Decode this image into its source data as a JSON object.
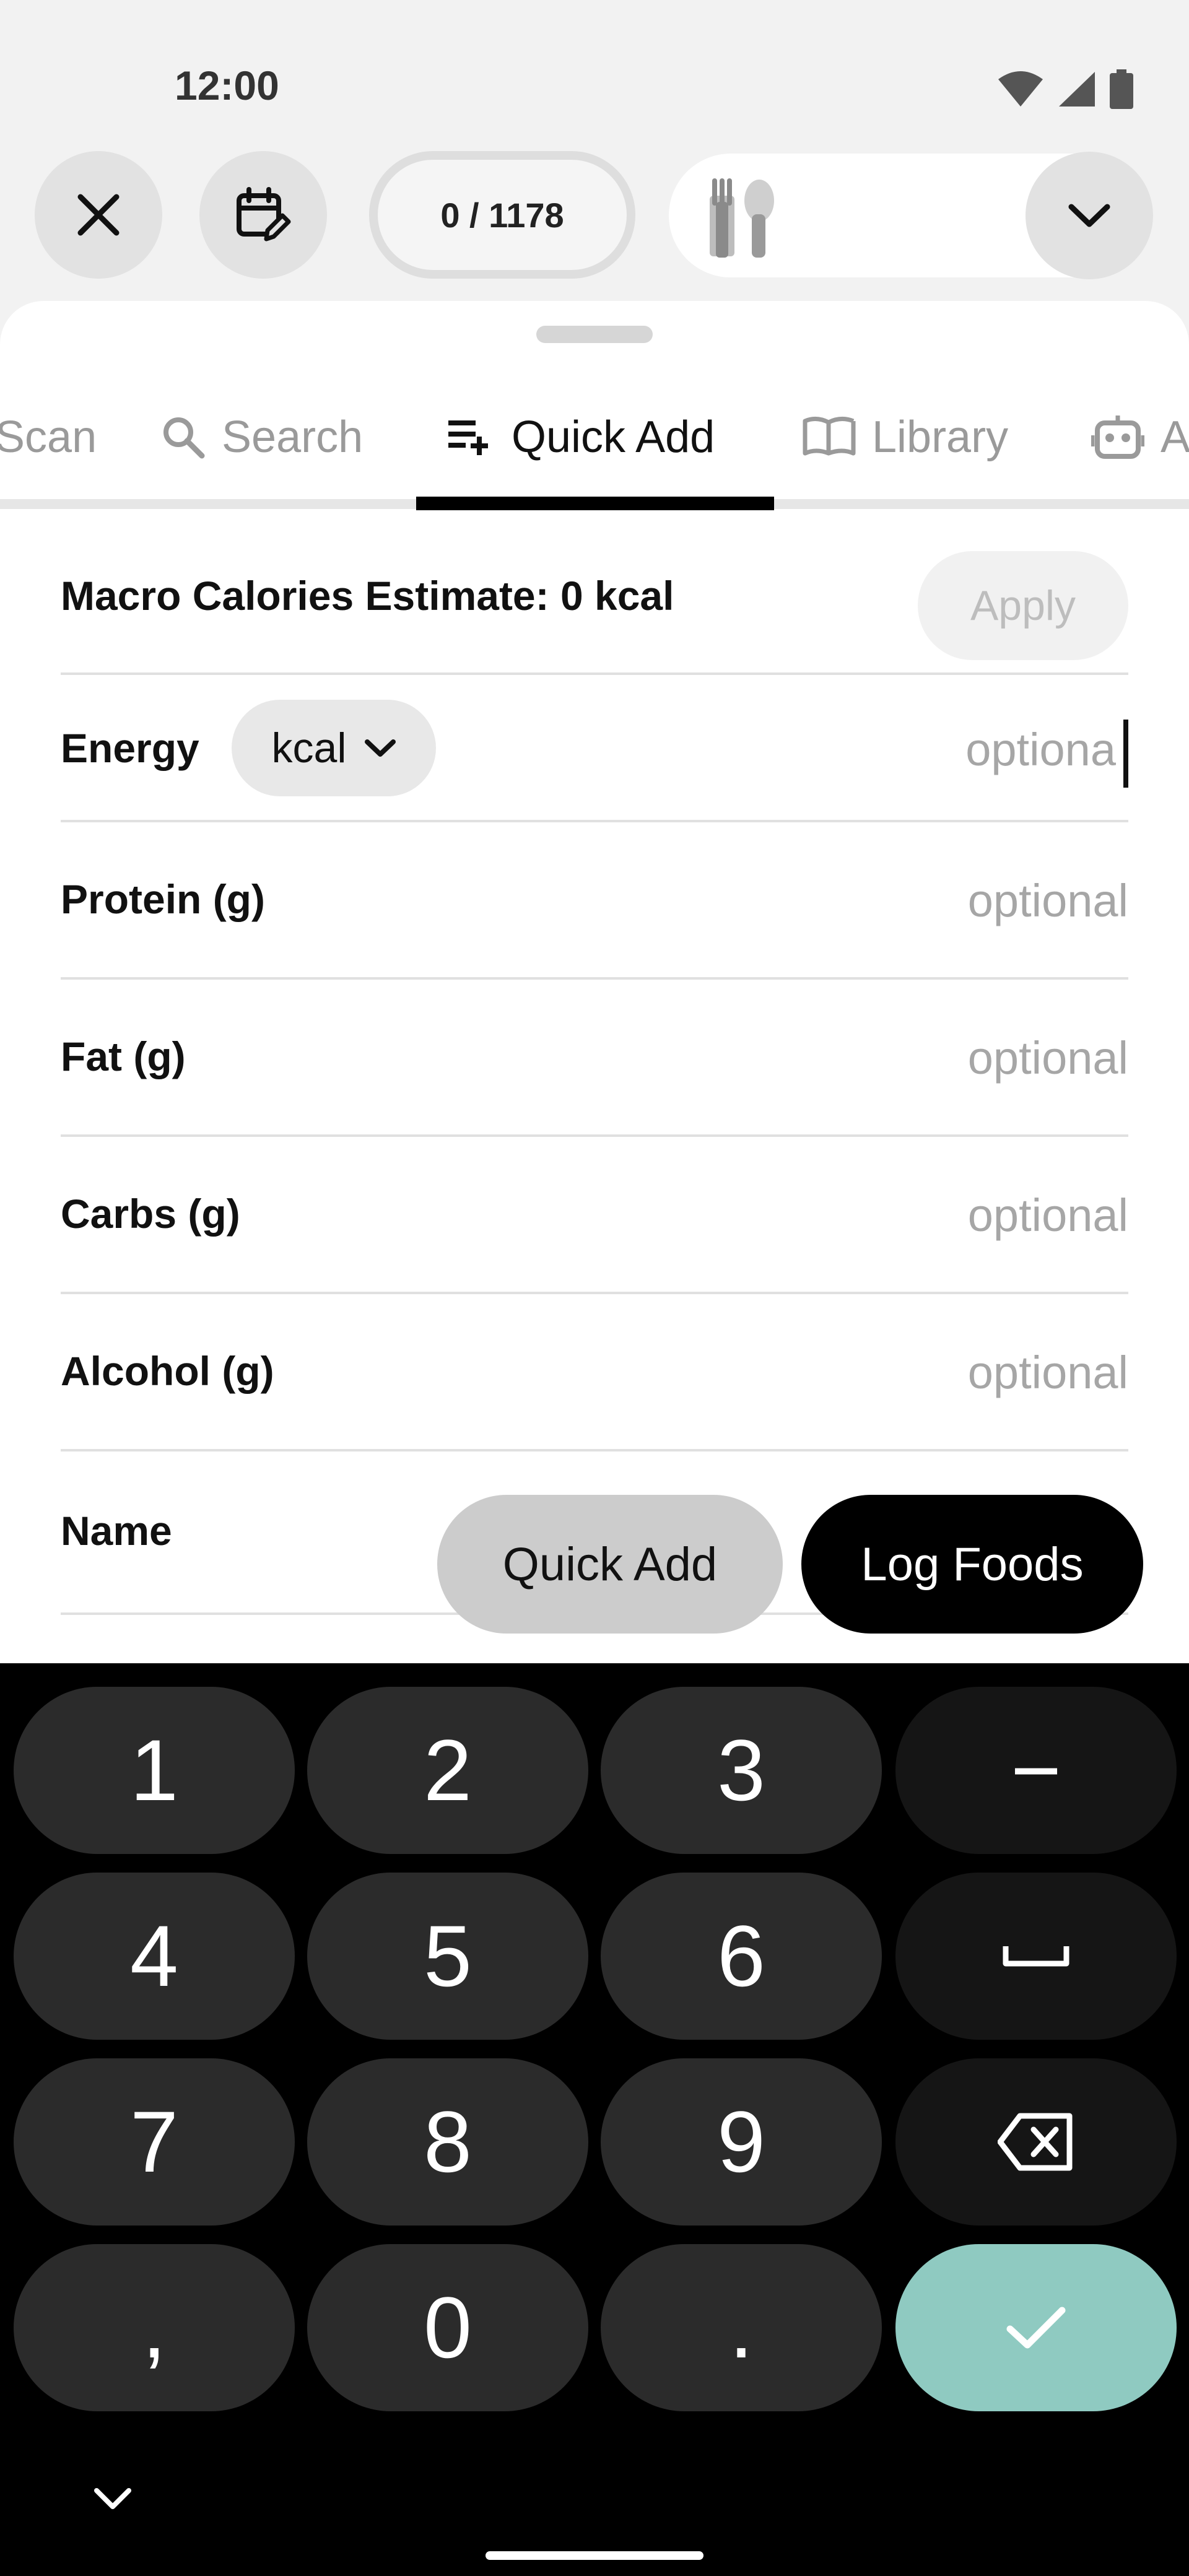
{
  "status_bar": {
    "time": "12:00"
  },
  "top_bar": {
    "counter": "0 / 1178"
  },
  "tabs": [
    {
      "label": "Scan"
    },
    {
      "label": "Search"
    },
    {
      "label": "Quick Add"
    },
    {
      "label": "Library"
    },
    {
      "label": "A"
    }
  ],
  "form": {
    "macro_estimate": "Macro Calories Estimate: 0 kcal",
    "apply_label": "Apply",
    "energy": {
      "label": "Energy",
      "unit": "kcal",
      "placeholder": "optiona"
    },
    "protein": {
      "label": "Protein (g)",
      "placeholder": "optional"
    },
    "fat": {
      "label": "Fat (g)",
      "placeholder": "optional"
    },
    "carbs": {
      "label": "Carbs (g)",
      "placeholder": "optional"
    },
    "alcohol": {
      "label": "Alcohol (g)",
      "placeholder": "optional"
    },
    "name": {
      "label": "Name"
    }
  },
  "actions": {
    "quick_add": "Quick Add",
    "log_foods": "Log Foods"
  },
  "keyboard": {
    "keys": [
      "1",
      "2",
      "3",
      "−",
      "4",
      "5",
      "6",
      "7",
      "8",
      "9",
      ",",
      "0",
      "."
    ]
  },
  "colors": {
    "enter_key": "#8fcac1",
    "accent_black": "#000000"
  }
}
